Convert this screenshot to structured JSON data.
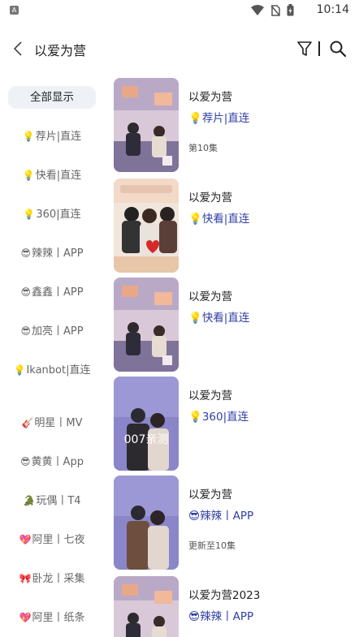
{
  "status": {
    "time": "10:14",
    "notif_icon": "A"
  },
  "appbar": {
    "title": "以爱为营"
  },
  "sidebar": {
    "items": [
      {
        "emoji": "",
        "label": "全部显示",
        "active": true
      },
      {
        "emoji": "💡",
        "label": "荐片|直连"
      },
      {
        "emoji": "💡",
        "label": "快看|直连"
      },
      {
        "emoji": "💡",
        "label": "360|直连"
      },
      {
        "emoji": "😎",
        "label": "辣辣丨APP"
      },
      {
        "emoji": "😎",
        "label": "鑫鑫丨APP"
      },
      {
        "emoji": "😎",
        "label": "加亮丨APP"
      },
      {
        "emoji": "💡",
        "label": "Ikanbot|直连"
      },
      {
        "emoji": "🎸",
        "label": "明星丨MV"
      },
      {
        "emoji": "😎",
        "label": "黄黄丨App"
      },
      {
        "emoji": "🐊",
        "label": "玩偶丨T4"
      },
      {
        "emoji": "💖",
        "label": "阿里丨七夜"
      },
      {
        "emoji": "🎀",
        "label": "卧龙丨采集"
      },
      {
        "emoji": "💖",
        "label": "阿里丨纸条"
      }
    ]
  },
  "results": [
    {
      "title": "以爱为营",
      "source_emoji": "💡",
      "source": "荐片|直连",
      "note": "第10集",
      "poster_text": ""
    },
    {
      "title": "以爱为营",
      "source_emoji": "💡",
      "source": "快看|直连",
      "note": "",
      "poster_text": ""
    },
    {
      "title": "以爱为营",
      "source_emoji": "💡",
      "source": "快看|直连",
      "note": "",
      "poster_text": ""
    },
    {
      "title": "以爱为营",
      "source_emoji": "💡",
      "source": "360|直连",
      "note": "",
      "poster_text": "007亲测"
    },
    {
      "title": "以爱为营",
      "source_emoji": "😎",
      "source": "辣辣丨APP",
      "note": "更新至10集",
      "poster_text": ""
    },
    {
      "title": "以爱为营2023",
      "source_emoji": "😎",
      "source": "辣辣丨APP",
      "note": "",
      "poster_text": ""
    }
  ],
  "colors": {
    "accent": "#2f3ea5",
    "sidebar_active_bg": "#eef1f6"
  }
}
